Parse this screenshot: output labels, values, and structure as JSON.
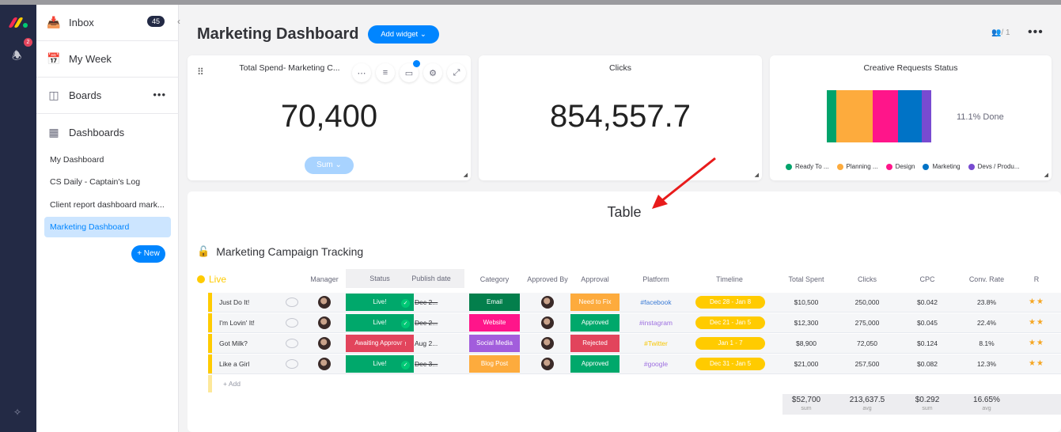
{
  "rail": {
    "notification_count": "2"
  },
  "sidebar": {
    "inbox": {
      "label": "Inbox",
      "count": "45"
    },
    "my_week": {
      "label": "My Week"
    },
    "boards": {
      "label": "Boards"
    },
    "dashboards": {
      "label": "Dashboards"
    },
    "dashboard_items": [
      {
        "label": "My Dashboard",
        "active": false
      },
      {
        "label": "CS Daily - Captain's Log",
        "active": false
      },
      {
        "label": "Client report dashboard mark...",
        "active": false
      },
      {
        "label": "Marketing Dashboard",
        "active": true
      }
    ],
    "new_button": "+ New"
  },
  "header": {
    "title": "Marketing Dashboard",
    "add_widget": "Add widget ⌄",
    "members": "/ 1"
  },
  "widgets": {
    "total_spend": {
      "title": "Total Spend- Marketing C... ",
      "value": "70,400",
      "aggregation": "Sum ⌄",
      "filter_badge": "1"
    },
    "clicks": {
      "title": "Clicks",
      "value": "854,557.7"
    },
    "creative_status": {
      "title": "Creative Requests Status",
      "done_label": "11.1% Done",
      "segments": [
        {
          "label": "Ready To ...",
          "color": "#00a36b",
          "share": 0.09
        },
        {
          "label": "Planning ...",
          "color": "#fdab3d",
          "share": 0.35
        },
        {
          "label": "Design",
          "color": "#ff158a",
          "share": 0.24
        },
        {
          "label": "Marketing",
          "color": "#0073c6",
          "share": 0.23
        },
        {
          "label": "Devs / Produ...",
          "color": "#784bd1",
          "share": 0.09
        }
      ]
    }
  },
  "table_widget": {
    "title": "Table",
    "board_name": "Marketing Campaign Tracking",
    "group_name": "Live",
    "columns": [
      "Manager",
      "Status",
      "Publish date",
      "Category",
      "Approved By",
      "Approval",
      "Platform",
      "Timeline",
      "Total Spent",
      "Clicks",
      "CPC",
      "Conv. Rate",
      "R"
    ],
    "rows": [
      {
        "name": "Just Do It!",
        "status": "Live!",
        "status_color": "#00a86b",
        "publish": "Dec 2...",
        "publish_ok": true,
        "category": "Email",
        "category_color": "#037f4c",
        "approval": "Need to Fix",
        "approval_color": "#fdab3d",
        "platform": "#facebook",
        "platform_color": "#3a7bd5",
        "timeline": "Dec 28 - Jan 8",
        "total_spent": "$10,500",
        "clicks": "250,000",
        "cpc": "$0.042",
        "conv_rate": "23.8%",
        "rating": "★★"
      },
      {
        "name": "I'm Lovin' It!",
        "status": "Live!",
        "status_color": "#00a86b",
        "publish": "Dec 2...",
        "publish_ok": true,
        "category": "Website",
        "category_color": "#ff158a",
        "approval": "Approved",
        "approval_color": "#00a86b",
        "platform": "#instagram",
        "platform_color": "#9d6fe0",
        "timeline": "Dec 21 - Jan 5",
        "total_spent": "$12,300",
        "clicks": "275,000",
        "cpc": "$0.045",
        "conv_rate": "22.4%",
        "rating": "★★"
      },
      {
        "name": "Got Milk?",
        "status": "Awaiting Approval",
        "status_color": "#e2445c",
        "publish": "Aug 2...",
        "publish_ok": false,
        "category": "Social Media",
        "category_color": "#a25ddc",
        "approval": "Rejected",
        "approval_color": "#e2445c",
        "platform": "#Twitter",
        "platform_color": "#f7c600",
        "timeline": "Jan 1 - 7",
        "total_spent": "$8,900",
        "clicks": "72,050",
        "cpc": "$0.124",
        "conv_rate": "8.1%",
        "rating": "★★"
      },
      {
        "name": "Like a Girl",
        "status": "Live!",
        "status_color": "#00a86b",
        "publish": "Dec 3...",
        "publish_ok": true,
        "category": "Blog Post",
        "category_color": "#fdab3d",
        "approval": "Approved",
        "approval_color": "#00a86b",
        "platform": "#google",
        "platform_color": "#9d6fe0",
        "timeline": "Dec 31 - Jan 5",
        "total_spent": "$21,000",
        "clicks": "257,500",
        "cpc": "$0.082",
        "conv_rate": "12.3%",
        "rating": "★★"
      }
    ],
    "add_label": "+ Add",
    "footer": {
      "total_spent": {
        "value": "$52,700",
        "fn": "sum"
      },
      "clicks": {
        "value": "213,637.5",
        "fn": "avg"
      },
      "cpc": {
        "value": "$0.292",
        "fn": "sum"
      },
      "conv_rate": {
        "value": "16.65%",
        "fn": "avg"
      }
    }
  }
}
